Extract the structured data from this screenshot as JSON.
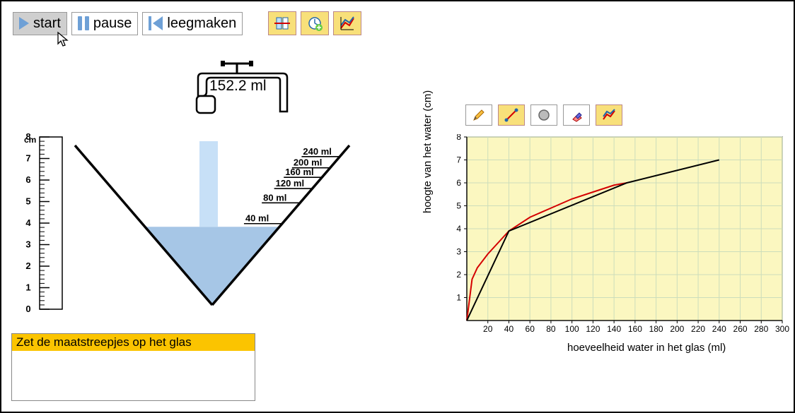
{
  "toolbar": {
    "start_label": "start",
    "pause_label": "pause",
    "reset_label": "leegmaken"
  },
  "faucet": {
    "readout": "152.2 ml"
  },
  "ruler": {
    "unit": "cm",
    "ticks": [
      8,
      7,
      6,
      5,
      4,
      3,
      2,
      1,
      0
    ]
  },
  "glass": {
    "markings": [
      "240 ml",
      "200 ml",
      "160 ml",
      "120 ml",
      "80 ml",
      "40 ml"
    ],
    "water_level_frac": 0.49
  },
  "status": {
    "message": "Zet de maatstreepjes op het glas"
  },
  "chart": {
    "ylabel": "hoogte van het water (cm)",
    "xlabel": "hoeveelheid water in het glas (ml)",
    "xticks": [
      20,
      40,
      60,
      80,
      100,
      120,
      140,
      160,
      180,
      200,
      220,
      240,
      260,
      280,
      300
    ],
    "yticks": [
      1,
      2,
      3,
      4,
      5,
      6,
      7,
      8
    ]
  },
  "chart_data": {
    "type": "line",
    "title": "",
    "xlabel": "hoeveelheid water in het glas (ml)",
    "ylabel": "hoogte van het water (cm)",
    "xlim": [
      0,
      300
    ],
    "ylim": [
      0,
      8
    ],
    "series": [
      {
        "name": "curve",
        "color": "#d40000",
        "x": [
          0,
          5,
          10,
          20,
          40,
          60,
          80,
          100,
          120,
          140,
          152.2
        ],
        "y": [
          0,
          1.8,
          2.3,
          2.9,
          3.9,
          4.5,
          4.9,
          5.3,
          5.6,
          5.9,
          6.0
        ]
      },
      {
        "name": "piecewise",
        "color": "#000000",
        "x": [
          0,
          40,
          152.2,
          240
        ],
        "y": [
          0,
          3.9,
          6.0,
          7.0
        ]
      }
    ]
  }
}
